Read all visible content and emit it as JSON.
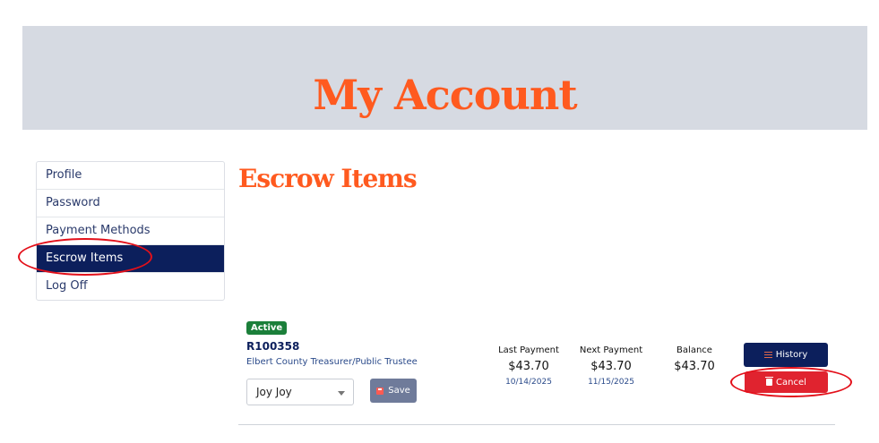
{
  "header": {
    "title": "My Account"
  },
  "sidebar": {
    "items": [
      {
        "label": "Profile"
      },
      {
        "label": "Password"
      },
      {
        "label": "Payment Methods"
      },
      {
        "label": "Escrow Items"
      },
      {
        "label": "Log Off"
      }
    ],
    "active_index": 3
  },
  "main": {
    "section_title": "Escrow Items",
    "escrow_item": {
      "status_badge": "Active",
      "id": "R100358",
      "organization": "Elbert County Treasurer/Public Trustee",
      "payment_method_select": {
        "value": "Joy Joy"
      },
      "save_label": "Save",
      "last_payment": {
        "label": "Last Payment",
        "amount": "$43.70",
        "date": "10/14/2025"
      },
      "next_payment": {
        "label": "Next Payment",
        "amount": "$43.70",
        "date": "11/15/2025"
      },
      "balance": {
        "label": "Balance",
        "amount": "$43.70"
      },
      "history_label": "History",
      "cancel_label": "Cancel"
    }
  },
  "colors": {
    "accent_orange": "#ff5a1f",
    "navy": "#0c1f5c",
    "banner_bg": "#d6dae2",
    "active_green": "#1b7f3a",
    "cancel_red": "#e0232f",
    "annotation_red": "#e3101a"
  },
  "icons": [
    "save-icon",
    "list-icon",
    "trash-icon",
    "chevron-down-icon"
  ]
}
